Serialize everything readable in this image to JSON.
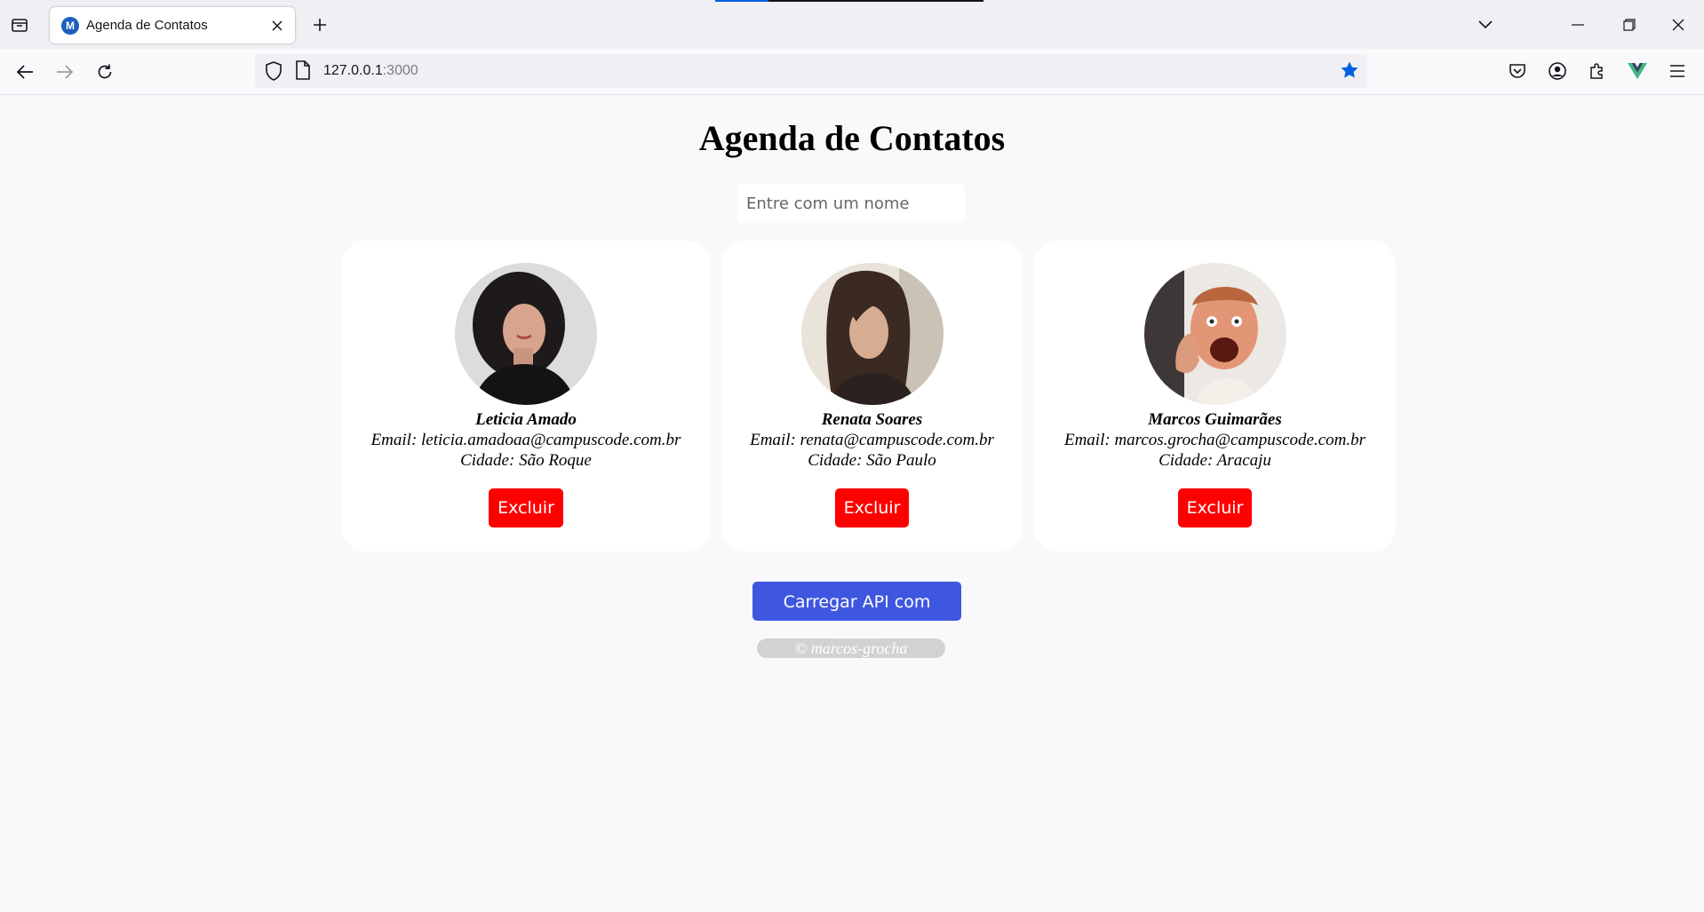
{
  "browser": {
    "tab_title": "Agenda de Contatos",
    "favicon_letter": "M",
    "url_host": "127.0.0.1",
    "url_port": ":3000"
  },
  "page": {
    "title": "Agenda de Contatos",
    "search_placeholder": "Entre com um nome",
    "load_button": "Carregar API com dados",
    "footer": "© marcos-grocha"
  },
  "contacts": [
    {
      "name": "Leticia Amado",
      "email": "Email: leticia.amadoaa@campuscode.com.br",
      "city": "Cidade: São Roque",
      "delete_label": "Excluir"
    },
    {
      "name": "Renata Soares",
      "email": "Email: renata@campuscode.com.br",
      "city": "Cidade: São Paulo",
      "delete_label": "Excluir"
    },
    {
      "name": "Marcos Guimarães",
      "email": "Email: marcos.grocha@campuscode.com.br",
      "city": "Cidade: Aracaju",
      "delete_label": "Excluir"
    }
  ],
  "colors": {
    "delete": "#ff0000",
    "load": "#3f57e0",
    "bookmark_star": "#0061e0"
  }
}
